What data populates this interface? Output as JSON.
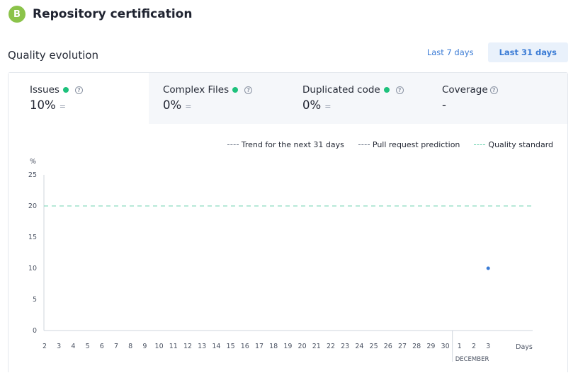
{
  "header": {
    "grade": "B",
    "title": "Repository certification"
  },
  "section": {
    "title": "Quality evolution"
  },
  "range": {
    "options": [
      "Last 7 days",
      "Last 31 days"
    ],
    "selected": "Last 31 days"
  },
  "tabs": [
    {
      "label": "Issues",
      "value": "10%",
      "trend": "=",
      "status_color": "#1ec17c",
      "has_dot": true
    },
    {
      "label": "Complex Files",
      "value": "0%",
      "trend": "=",
      "status_color": "#1ec17c",
      "has_dot": true
    },
    {
      "label": "Duplicated code",
      "value": "0%",
      "trend": "=",
      "status_color": "#1ec17c",
      "has_dot": true
    },
    {
      "label": "Coverage",
      "value": "-",
      "trend": "",
      "status_color": "",
      "has_dot": false
    }
  ],
  "legend": [
    {
      "label": "Trend for the next 31 days",
      "color": "#6e7888"
    },
    {
      "label": "Pull request prediction",
      "color": "#6e7888"
    },
    {
      "label": "Quality standard",
      "color": "#6fd3b0"
    }
  ],
  "chart_data": {
    "type": "line",
    "ylabel": "%",
    "xlabel": "Days",
    "ylim": [
      0,
      25
    ],
    "yticks": [
      0,
      5,
      10,
      15,
      20,
      25
    ],
    "x_ticks": [
      "2",
      "3",
      "4",
      "5",
      "6",
      "7",
      "8",
      "9",
      "10",
      "11",
      "12",
      "13",
      "14",
      "15",
      "16",
      "17",
      "18",
      "19",
      "20",
      "21",
      "22",
      "23",
      "24",
      "25",
      "26",
      "27",
      "28",
      "29",
      "30",
      "1",
      "2",
      "3"
    ],
    "month_label": "DECEMBER",
    "quality_standard": 20,
    "series": [
      {
        "name": "Issues",
        "color": "#3a7bd5",
        "points": [
          {
            "x": "3",
            "y": 10
          }
        ]
      }
    ]
  }
}
